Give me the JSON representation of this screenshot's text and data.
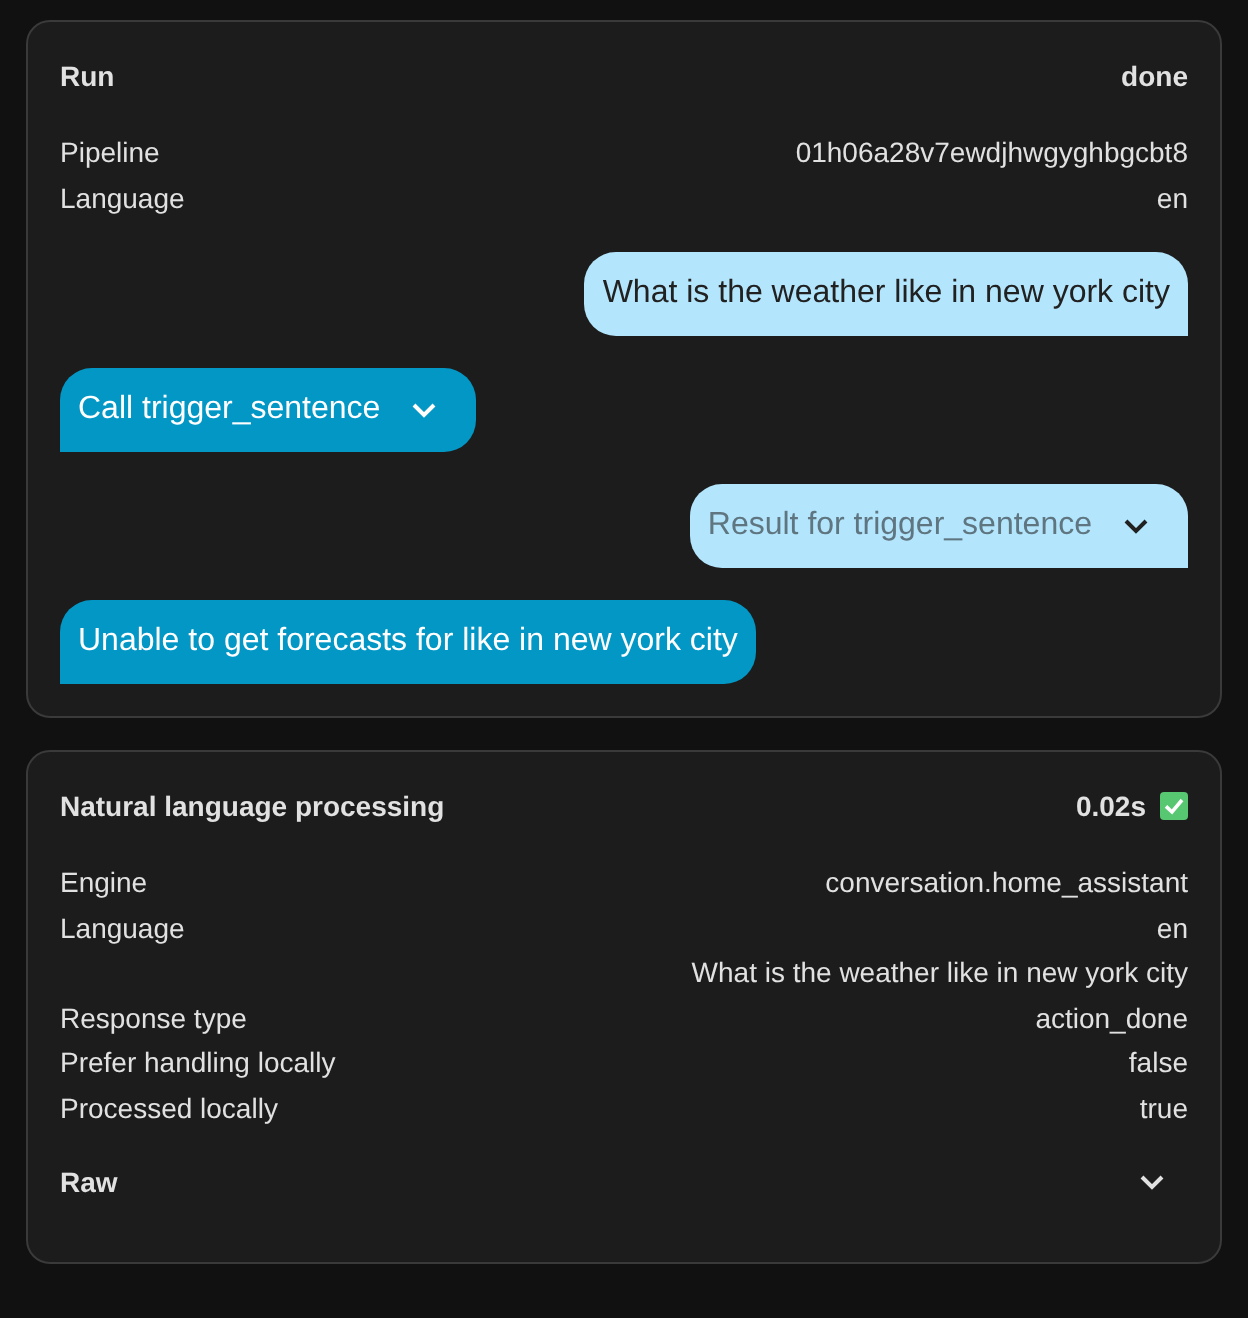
{
  "run_card": {
    "title": "Run",
    "status": "done",
    "rows": [
      {
        "label": "Pipeline",
        "value": "01h06a28v7ewdjhwgyghbgcbt8"
      },
      {
        "label": "Language",
        "value": "en"
      }
    ],
    "messages": [
      {
        "kind": "user",
        "text": "What is the weather like in new york city",
        "expandable": false
      },
      {
        "kind": "assistant",
        "text": "Call trigger_sentence",
        "expandable": true
      },
      {
        "kind": "user",
        "text": "Result for trigger_sentence",
        "expandable": true
      },
      {
        "kind": "assistant",
        "text": "Unable to get forecasts for like in new york city",
        "expandable": false
      }
    ]
  },
  "nlp_card": {
    "title": "Natural language processing",
    "duration": "0.02s",
    "success": true,
    "rows": [
      {
        "label": "Engine",
        "value": "conversation.home_assistant"
      },
      {
        "label": "Language",
        "value": "en"
      },
      {
        "value": "What is the weather like in new york city"
      },
      {
        "label": "Response type",
        "value": "action_done"
      },
      {
        "label": "Prefer handling locally",
        "value": "false"
      },
      {
        "label": "Processed locally",
        "value": "true"
      }
    ],
    "raw_label": "Raw"
  }
}
